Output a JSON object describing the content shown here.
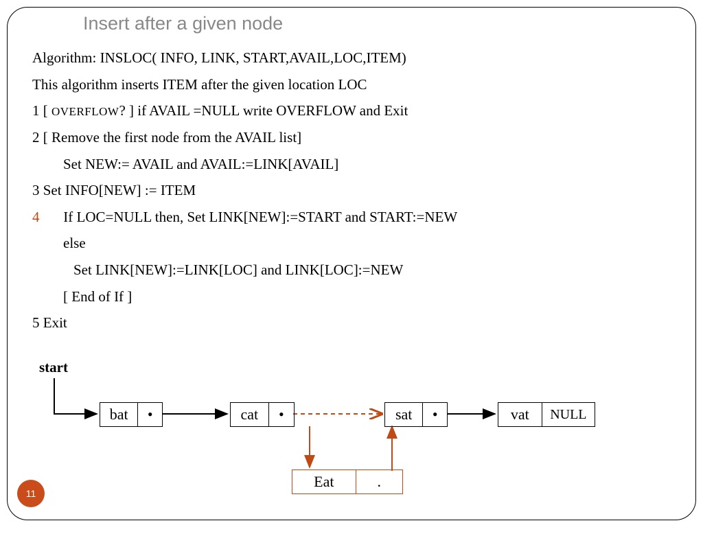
{
  "title": "Insert after a given node",
  "algo": {
    "header": "Algorithm: INSLOC( INFO, LINK, START,AVAIL,LOC,ITEM)",
    "desc": "This algorithm inserts ITEM after the given location LOC",
    "step1_prefix": "1  [ ",
    "step1_overflow": "OVERFLOW",
    "step1_rest": "? ] if AVAIL =NULL write OVERFLOW and Exit",
    "step2": "2  [ Remove the first node from the AVAIL list]",
    "step2_set": "Set NEW:= AVAIL and AVAIL:=LINK[AVAIL]",
    "step3": "3  Set INFO[NEW] := ITEM",
    "step4_num": "4",
    "step4_text": "If LOC=NULL then, Set LINK[NEW]:=START and START:=NEW",
    "step4_else": "else",
    "step4_set": "Set LINK[NEW]:=LINK[LOC] and LINK[LOC]:=NEW",
    "step4_end": "[ End of If ]",
    "step5": "5 Exit"
  },
  "diagram": {
    "start_label": "start",
    "nodes": {
      "bat": {
        "info": "bat",
        "link": "•"
      },
      "cat": {
        "info": "cat",
        "link": "•"
      },
      "sat": {
        "info": "sat",
        "link": "•"
      },
      "vat": {
        "info": "vat",
        "link": "NULL"
      },
      "eat": {
        "info": "Eat",
        "link": "."
      }
    }
  },
  "page_number": "11"
}
